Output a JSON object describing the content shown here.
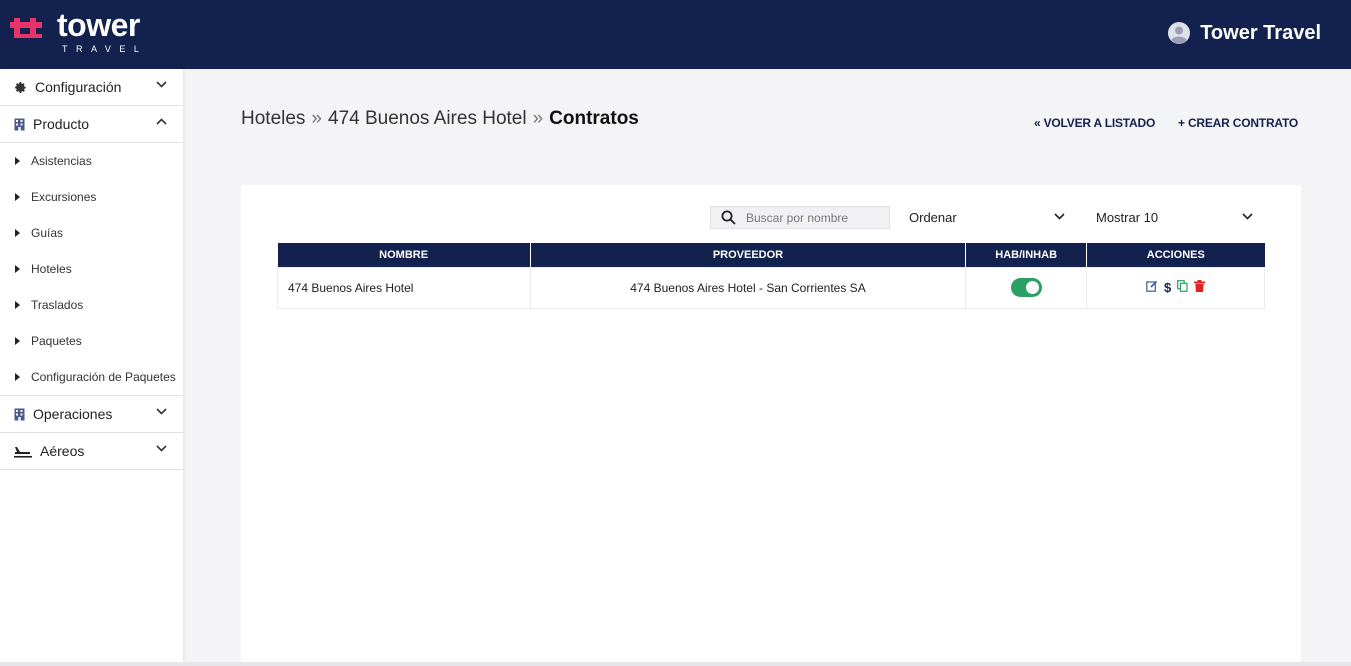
{
  "header": {
    "logo_word": "tower",
    "logo_sub": "TRAVEL",
    "user_name": "Tower Travel",
    "colors": {
      "bar": "#13214f",
      "logo_mark": "#e8336b"
    }
  },
  "sidebar": {
    "sections": [
      {
        "label": "Configuración",
        "icon": "gear-icon",
        "expanded": false
      },
      {
        "label": "Producto",
        "icon": "building-icon",
        "expanded": true,
        "items": [
          "Asistencias",
          "Excursiones",
          "Guías",
          "Hoteles",
          "Traslados",
          "Paquetes",
          "Configuración de Paquetes"
        ]
      },
      {
        "label": "Operaciones",
        "icon": "building-icon",
        "expanded": false
      },
      {
        "label": "Aéreos",
        "icon": "plane-icon",
        "expanded": false
      }
    ]
  },
  "breadcrumb": {
    "items": [
      "Hoteles",
      "474 Buenos Aires Hotel",
      "Contratos"
    ],
    "separator": "»"
  },
  "actions": {
    "back": "« VOLVER A LISTADO",
    "create": "+ CREAR CONTRATO"
  },
  "filters": {
    "search_placeholder": "Buscar por nombre",
    "order_label": "Ordenar",
    "show_label": "Mostrar 10"
  },
  "table": {
    "columns": [
      "NOMBRE",
      "PROVEEDOR",
      "HAB/INHAB",
      "ACCIONES"
    ],
    "rows": [
      {
        "nombre": "474 Buenos Aires Hotel",
        "proveedor": "474 Buenos Aires Hotel - San Corrientes SA",
        "enabled": true,
        "actions": [
          "edit-icon",
          "price-icon",
          "copy-icon",
          "trash-icon"
        ],
        "price_symbol": "$"
      }
    ]
  }
}
